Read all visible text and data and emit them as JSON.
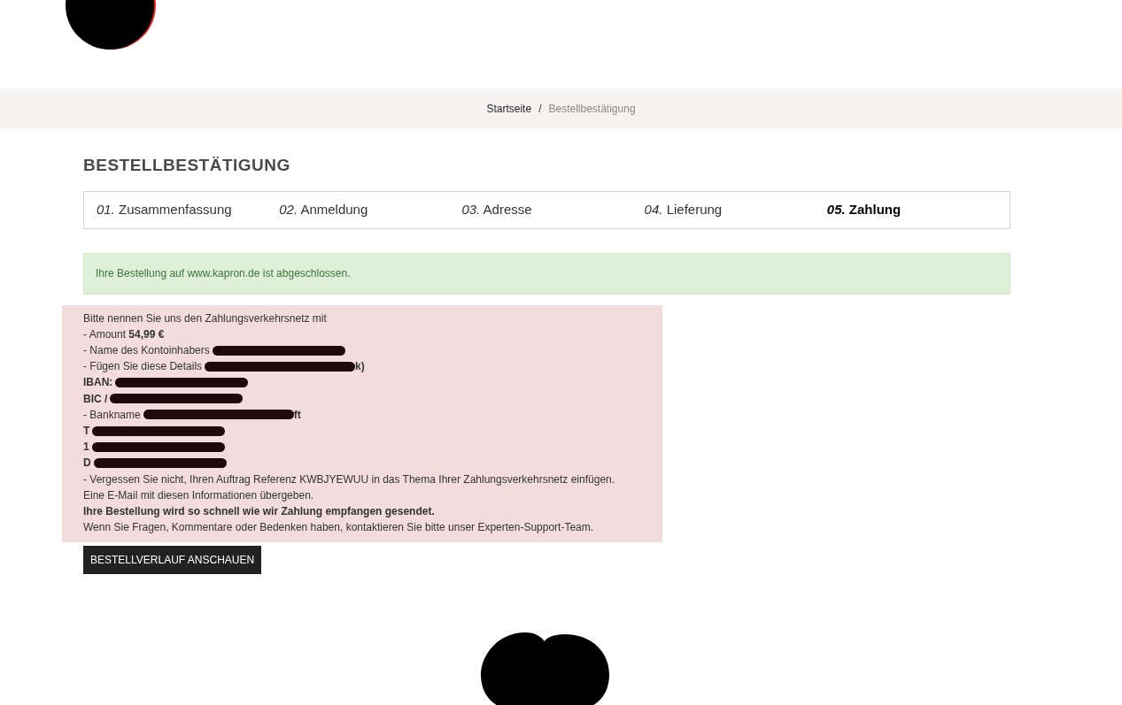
{
  "breadcrumb_separator": "/",
  "breadcrumb": [
    {
      "label": "Startseite",
      "current": false
    },
    {
      "label": "Bestellbestätigung",
      "current": true
    }
  ],
  "heading": "BESTELLBESTÄTIGUNG",
  "steps": [
    {
      "number": "01.",
      "label": "Zusammenfassung",
      "selected": false
    },
    {
      "number": "02.",
      "label": "Anmeldung",
      "selected": false
    },
    {
      "number": "03.",
      "label": "Adresse",
      "selected": false
    },
    {
      "number": "04.",
      "label": "Lieferung",
      "selected": false
    },
    {
      "number": "05.",
      "label": "Zahlung",
      "selected": true
    }
  ],
  "success_message": "Ihre Bestellung auf www.kapron.de ist abgeschlossen.",
  "payment_lines": [
    {
      "text": "Bitte nennen Sie uns den Zahlungsverkehrsnetz mit",
      "bold": false,
      "redacted": false
    },
    {
      "text": "- Amount **54,99 €**",
      "bold": false,
      "redacted": false
    },
    {
      "text": "- Name des Kontoinhabers",
      "bold": false,
      "redacted": true
    },
    {
      "text": "- Fügen Sie diese Details",
      "bold": false,
      "redacted": true,
      "tail": "k)"
    },
    {
      "text": "IBAN:",
      "bold": true,
      "redacted": true
    },
    {
      "text": "BIC /",
      "bold": true,
      "redacted": true
    },
    {
      "text": "- Bankname",
      "bold": false,
      "redacted": true,
      "tail": "ft"
    },
    {
      "text": "T",
      "bold": true,
      "redacted": true
    },
    {
      "text": "1",
      "bold": true,
      "redacted": true
    },
    {
      "text": "D",
      "bold": true,
      "redacted": true
    },
    {
      "text": "- Vergessen Sie nicht, Ihren Auftrag Referenz KWBJYEWUU in das Thema Ihrer Zahlungsverkehrsnetz einfügen.",
      "bold": false,
      "redacted": false
    },
    {
      "text": "Eine E-Mail mit diesen Informationen übergeben.",
      "bold": false,
      "redacted": false
    },
    {
      "text": "Ihre Bestellung wird so schnell wie wir Zahlung empfangen gesendet.",
      "bold": true,
      "redacted": false
    },
    {
      "text": "Wenn Sie Fragen, Kommentare oder Bedenken haben, kontaktieren Sie bitte unser Experten-Support-Team.",
      "bold": false,
      "redacted": false
    }
  ],
  "button": "BESTELLVERLAUF ANSCHAUEN"
}
